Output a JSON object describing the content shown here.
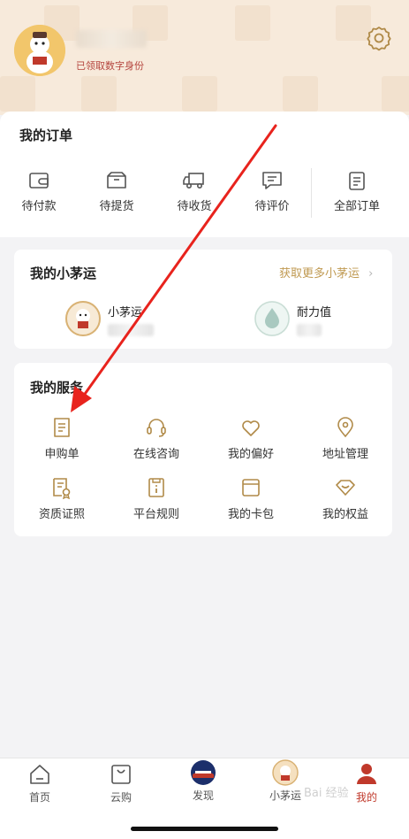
{
  "header": {
    "identity_text": "已领取数字身份"
  },
  "orders": {
    "title": "我的订单",
    "items": [
      {
        "label": "待付款",
        "icon": "wallet-icon"
      },
      {
        "label": "待提货",
        "icon": "box-icon"
      },
      {
        "label": "待收货",
        "icon": "truck-icon"
      },
      {
        "label": "待评价",
        "icon": "comment-icon"
      },
      {
        "label": "全部订单",
        "icon": "clipboard-icon"
      }
    ]
  },
  "fortune": {
    "title": "我的小茅运",
    "more_link": "获取更多小茅运",
    "items": [
      {
        "label": "小茅运",
        "icon": "mascot-icon"
      },
      {
        "label": "耐力值",
        "icon": "water-drop-icon"
      }
    ]
  },
  "services": {
    "title": "我的服务",
    "items": [
      {
        "label": "申购单",
        "icon": "note-icon"
      },
      {
        "label": "在线咨询",
        "icon": "headset-icon"
      },
      {
        "label": "我的偏好",
        "icon": "heart-icon"
      },
      {
        "label": "地址管理",
        "icon": "location-pin-icon"
      },
      {
        "label": "资质证照",
        "icon": "certificate-icon"
      },
      {
        "label": "平台规则",
        "icon": "rules-book-icon"
      },
      {
        "label": "我的卡包",
        "icon": "card-wallet-icon"
      },
      {
        "label": "我的权益",
        "icon": "rights-icon"
      }
    ]
  },
  "tabbar": {
    "items": [
      {
        "label": "首页",
        "icon": "home-icon"
      },
      {
        "label": "云购",
        "icon": "shopping-bag-icon"
      },
      {
        "label": "发现",
        "icon": "discover-icon"
      },
      {
        "label": "小茅运",
        "icon": "mascot-icon"
      },
      {
        "label": "我的",
        "icon": "profile-icon",
        "active": true
      }
    ]
  },
  "watermark": "Bai 经验",
  "colors": {
    "accent_gold": "#c09a52",
    "active_red": "#c0392b",
    "header_bg": "#f7eadb",
    "arrow_red": "#e8231d"
  }
}
